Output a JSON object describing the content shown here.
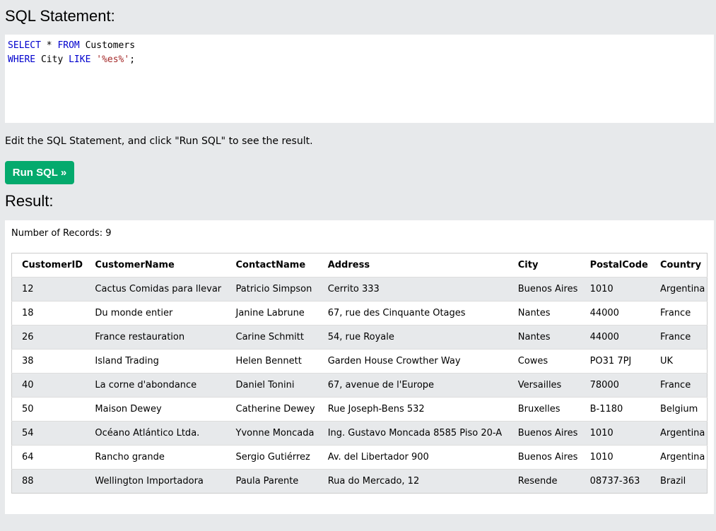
{
  "sql_section": {
    "title": "SQL Statement:",
    "code": {
      "line1": {
        "kw1": "SELECT",
        "rest1": " * ",
        "kw2": "FROM",
        "rest2": " Customers"
      },
      "line2": {
        "kw1": "WHERE",
        "rest1": " City ",
        "kw2": "LIKE",
        "str": "'%es%'",
        "end": ";"
      }
    },
    "instruction": "Edit the SQL Statement, and click \"Run SQL\" to see the result.",
    "run_button": "Run SQL »"
  },
  "result_section": {
    "title": "Result:",
    "records_label": "Number of Records: 9",
    "columns": [
      "CustomerID",
      "CustomerName",
      "ContactName",
      "Address",
      "City",
      "PostalCode",
      "Country"
    ],
    "rows": [
      [
        "12",
        "Cactus Comidas para llevar",
        "Patricio Simpson",
        "Cerrito 333",
        "Buenos Aires",
        "1010",
        "Argentina"
      ],
      [
        "18",
        "Du monde entier",
        "Janine Labrune",
        "67, rue des Cinquante Otages",
        "Nantes",
        "44000",
        "France"
      ],
      [
        "26",
        "France restauration",
        "Carine Schmitt",
        "54, rue Royale",
        "Nantes",
        "44000",
        "France"
      ],
      [
        "38",
        "Island Trading",
        "Helen Bennett",
        "Garden House Crowther Way",
        "Cowes",
        "PO31 7PJ",
        "UK"
      ],
      [
        "40",
        "La corne d'abondance",
        "Daniel Tonini",
        "67, avenue de l'Europe",
        "Versailles",
        "78000",
        "France"
      ],
      [
        "50",
        "Maison Dewey",
        "Catherine Dewey",
        "Rue Joseph-Bens 532",
        "Bruxelles",
        "B-1180",
        "Belgium"
      ],
      [
        "54",
        "Océano Atlántico Ltda.",
        "Yvonne Moncada",
        "Ing. Gustavo Moncada 8585 Piso 20-A",
        "Buenos Aires",
        "1010",
        "Argentina"
      ],
      [
        "64",
        "Rancho grande",
        "Sergio Gutiérrez",
        "Av. del Libertador 900",
        "Buenos Aires",
        "1010",
        "Argentina"
      ],
      [
        "88",
        "Wellington Importadora",
        "Paula Parente",
        "Rua do Mercado, 12",
        "Resende",
        "08737-363",
        "Brazil"
      ]
    ]
  },
  "colors": {
    "page_bg": "#e7e9eb",
    "button_bg": "#04aa6d",
    "keyword": "#0000cd",
    "string": "#a52a2a"
  }
}
